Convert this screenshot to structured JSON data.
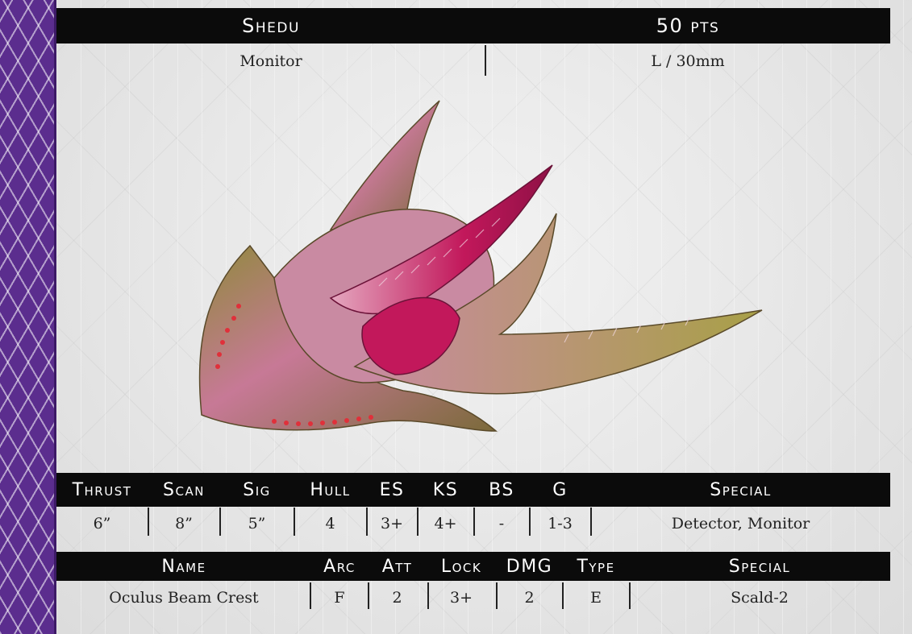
{
  "header": {
    "name": "Shedu",
    "points": "50 pts"
  },
  "subheader": {
    "role": "Monitor",
    "size": "L / 30mm"
  },
  "stats": {
    "headers": [
      "Thrust",
      "Scan",
      "Sig",
      "Hull",
      "ES",
      "KS",
      "BS",
      "G",
      "Special"
    ],
    "values": [
      "6”",
      "8”",
      "5”",
      "4",
      "3+",
      "4+",
      "-",
      "1-3",
      "Detector, Monitor"
    ]
  },
  "weapons": {
    "headers": [
      "Name",
      "Arc",
      "Att",
      "Lock",
      "DMG",
      "Type",
      "Special"
    ],
    "rows": [
      [
        "Oculus Beam Crest",
        "F",
        "2",
        "3+",
        "2",
        "E",
        "Scald-2"
      ]
    ]
  },
  "colors": {
    "strip": "#5b2d8e",
    "bar": "#0b0b0b",
    "ship_pink": "#c2185b",
    "ship_gold": "#8f8a3c"
  }
}
